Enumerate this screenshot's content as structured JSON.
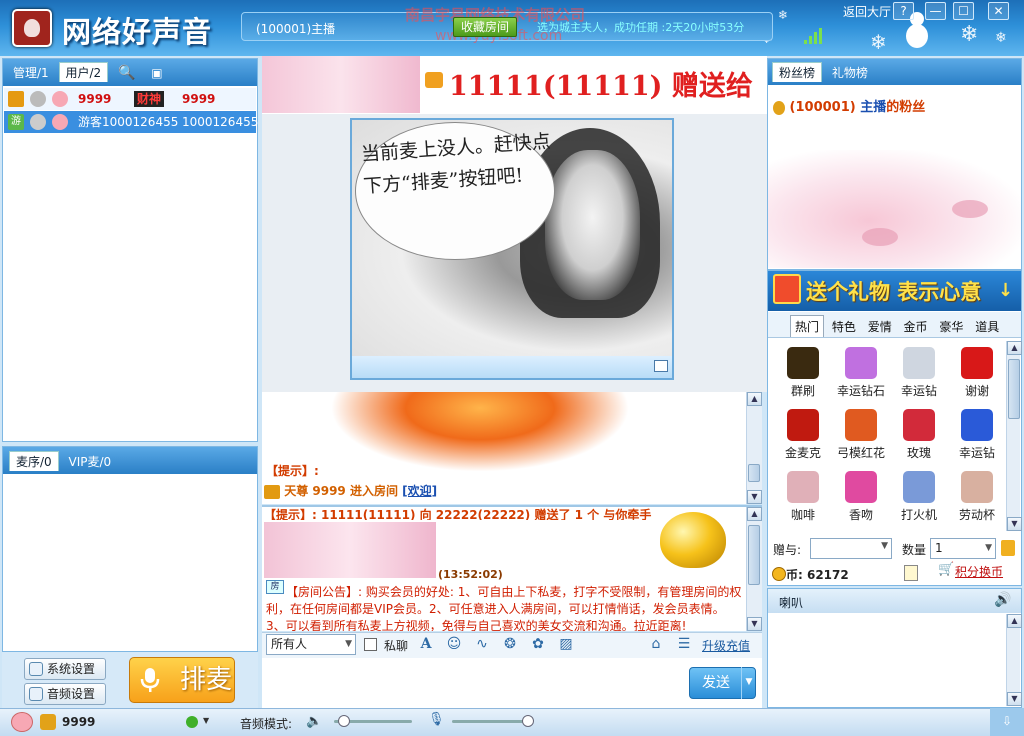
{
  "titlebar": {
    "app_title": "网络好声音",
    "host_label": "(100001)主播",
    "favorite_button": "收藏房间",
    "company_name": "南昌宇易网络技术有限公司",
    "company_url": "www.yuyisoft.com",
    "owner_notice": "选为城主夫人，成功任期 :2天20小时53分",
    "back_hall": "返回大厅",
    "window_buttons": [
      "?",
      "—",
      "☐",
      "✕"
    ]
  },
  "left_users": {
    "tabs": [
      "管理/1",
      "用户/2"
    ],
    "active_tab": 1,
    "rows": [
      {
        "name": "9999",
        "tag": "财神",
        "score": "9999"
      },
      {
        "badge": "游",
        "name": "游客1000126455",
        "score": "1000126455"
      }
    ]
  },
  "left_mic": {
    "tabs": [
      "麦序/0",
      "VIP麦/0"
    ],
    "active_tab": 0
  },
  "left_bottom": {
    "system_settings": "系统设置",
    "audio_settings": "音频设置",
    "queue_button": "排麦"
  },
  "gift_banner": {
    "text": "11111(11111) 赠送给"
  },
  "video": {
    "no_mic_text": "当前麦上没人。赶快点下方“排麦”按钮吧!"
  },
  "public_chat": {
    "tip": "【提示】:",
    "enter_user": "天尊 9999",
    "enter_action": "进入房间",
    "welcome": "[欢迎]"
  },
  "private_chat": {
    "header": "【提示】: 11111(11111) 向 22222(22222) 赠送了 1 个 与你牵手",
    "time": "(13:52:02)",
    "notice_icon": "房",
    "notice": "【房间公告】: 购买会员的好处: 1、可自由上下私麦，打字不受限制，有管理房间的权利，在任何房间都是VIP会员。2、可任意进入人满房间，可以打情悄话，发会员表情。3、可以看到所有私麦上方视频，免得与自己喜欢的美女交流和沟通。拉近距离!"
  },
  "input_toolbar": {
    "target": "所有人",
    "private_label": "私聊",
    "recharge": "升级充值",
    "send": "发送"
  },
  "fans": {
    "tabs": [
      "粉丝榜",
      "礼物榜"
    ],
    "active_tab": 0,
    "title_id": "(100001)",
    "title_name": "主播",
    "title_suffix": "的粉丝"
  },
  "gifts": {
    "slogan": "送个礼物 表示心意",
    "tabs": [
      "热门",
      "特色",
      "爱情",
      "金币",
      "豪华",
      "道具"
    ],
    "active_tab": 0,
    "items": [
      {
        "label": "群刷",
        "color": "#3a2a10"
      },
      {
        "label": "幸运钻石",
        "color": "#c070e0"
      },
      {
        "label": "幸运钻",
        "color": "#cfd6e0"
      },
      {
        "label": "谢谢",
        "color": "#d81818"
      },
      {
        "label": "金麦克",
        "color": "#c01a10"
      },
      {
        "label": "弓模红花",
        "color": "#e05a20"
      },
      {
        "label": "玫瑰",
        "color": "#d22a3a"
      },
      {
        "label": "幸运钻",
        "color": "#2a5ad8"
      },
      {
        "label": "咖啡",
        "color": "#e0b0b8"
      },
      {
        "label": "香吻",
        "color": "#e04aa0"
      },
      {
        "label": "打火机",
        "color": "#7a9ad8"
      },
      {
        "label": "劳动杯",
        "color": "#d8b0a0"
      }
    ],
    "give_label": "赠与:",
    "give_value": "",
    "qty_label": "数量",
    "qty_value": "1",
    "coin_label": "币: 62172",
    "exchange": "积分换币"
  },
  "speaker": {
    "label": "喇叭"
  },
  "status_bar": {
    "user_name": "9999",
    "audio_mode_label": "音频模式:"
  }
}
